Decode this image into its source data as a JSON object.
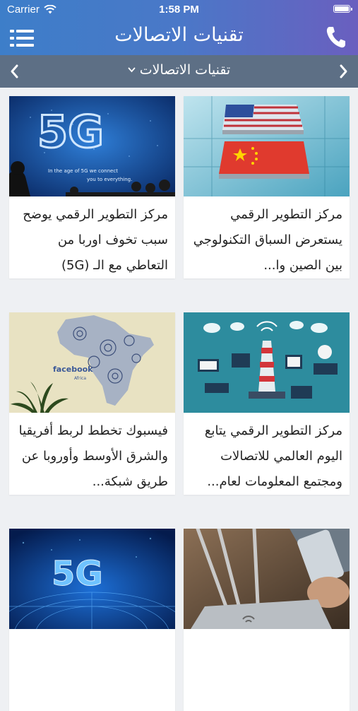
{
  "status_bar": {
    "carrier": "Carrier",
    "time": "1:58 PM"
  },
  "nav": {
    "title": "تقنيات الاتصالات"
  },
  "section": {
    "title": "تقنيات الاتصالات"
  },
  "icons": {
    "menu": "menu-icon",
    "phone": "phone-icon",
    "chevron_left": "chevron-left-icon",
    "chevron_right": "chevron-right-icon",
    "dropdown": "chevron-down-icon"
  },
  "colors": {
    "nav_start": "#3d7ec9",
    "nav_end": "#6a5fbf",
    "section_bar": "#5d6f85"
  },
  "articles": [
    {
      "title": "مركز التطوير الرقمي يوضح سبب تخوف اوربا من التعاطي مع الـ (5G)",
      "image": "5G conference screen"
    },
    {
      "title": "مركز التطوير الرقمي يستعرض السباق التكنولوجي بين الصين وا...",
      "image": "US and China flag chips"
    },
    {
      "title": "فيسبوك تخطط لربط أفريقيا والشرق الأوسط وأوروبا عن طريق شبكة...",
      "image": "facebook Africa map"
    },
    {
      "title": "مركز التطوير الرقمي يتابع اليوم العالمي للاتصالات ومجتمع المعلومات لعام...",
      "image": "telecom tower network illustration"
    },
    {
      "title": "",
      "image": "5G blue globe"
    },
    {
      "title": "",
      "image": "wifi router and phone"
    }
  ]
}
